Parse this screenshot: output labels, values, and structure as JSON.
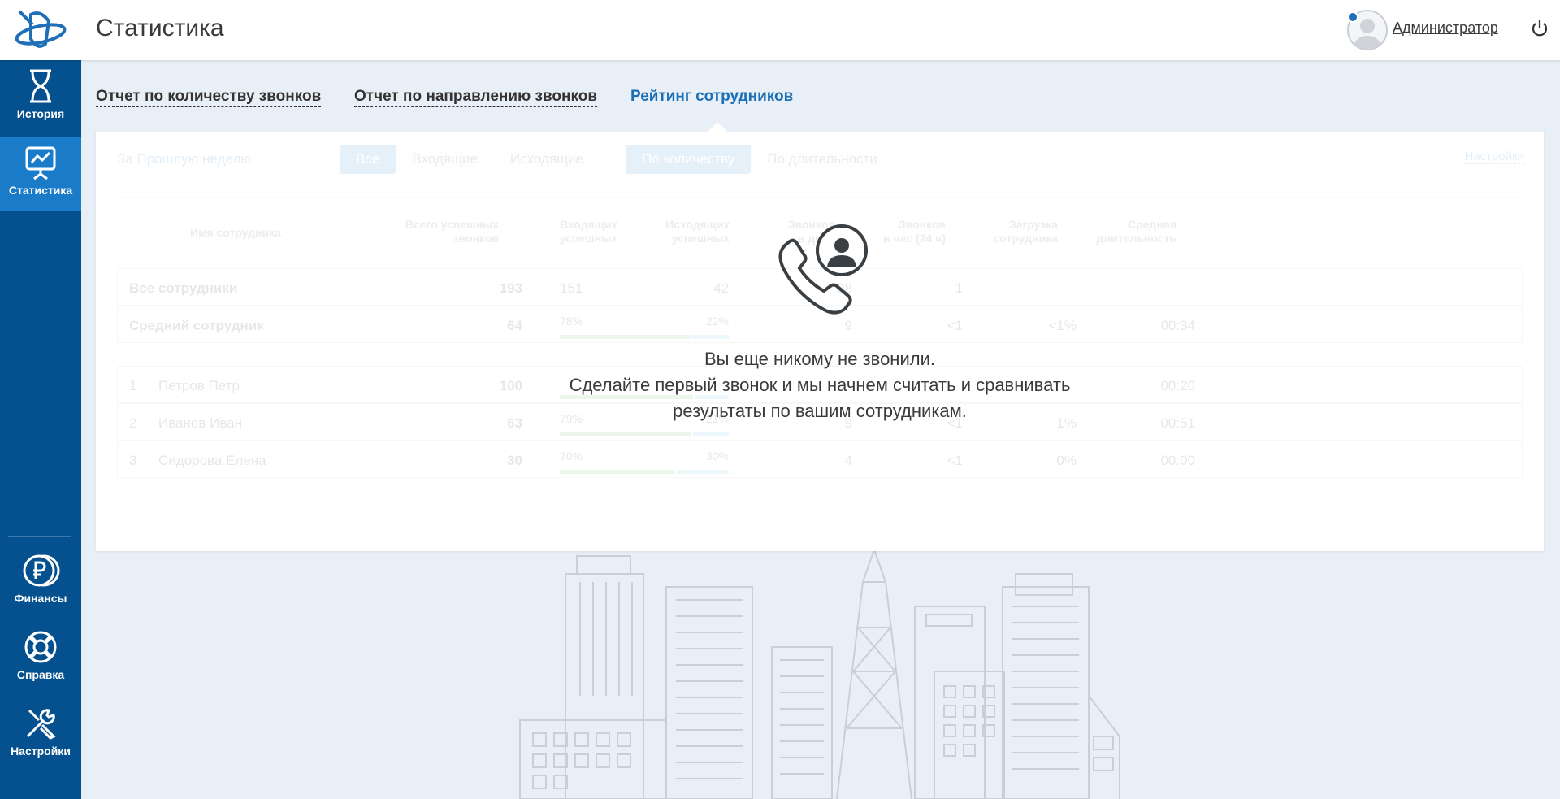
{
  "header": {
    "title": "Статистика",
    "user_name": "Администратор"
  },
  "sidebar": {
    "items": [
      {
        "label": "История",
        "icon": "hourglass-icon",
        "active": false
      },
      {
        "label": "Статистика",
        "icon": "presentation-chart-icon",
        "active": true
      },
      {
        "label": "Финансы",
        "icon": "ruble-coins-icon",
        "active": false
      },
      {
        "label": "Справка",
        "icon": "lifebuoy-icon",
        "active": false
      },
      {
        "label": "Настройки",
        "icon": "tools-icon",
        "active": false
      }
    ]
  },
  "tabs": [
    {
      "label": "Отчет по количеству звонков",
      "active": false
    },
    {
      "label": "Отчет по направлению звонков",
      "active": false
    },
    {
      "label": "Рейтинг сотрудников",
      "active": true
    }
  ],
  "filters": {
    "period_prefix": "За",
    "period_value": "Прошлую неделю",
    "direction": [
      "Все",
      "Входящие",
      "Исходящие"
    ],
    "direction_selected": "Все",
    "metric": [
      "По количеству",
      "По длительности"
    ],
    "metric_selected": "По количеству",
    "settings_label": "Настройки"
  },
  "table": {
    "columns": {
      "name": "Имя сотрудника",
      "total": [
        "Всего успешных",
        "звонков"
      ],
      "incoming": [
        "Входящих",
        "успешных"
      ],
      "outgoing": [
        "Исходящих",
        "успешных"
      ],
      "calls": [
        "Звонков",
        "в день"
      ],
      "per_hour": [
        "Звонков",
        "в час (24 ч)"
      ],
      "load": [
        "Загрузка",
        "сотрудника"
      ],
      "avg": [
        "Средняя",
        "длительность"
      ]
    },
    "summary": [
      {
        "name": "Все сотрудники",
        "total": "193",
        "incoming": "151",
        "outgoing": "42",
        "calls": "28",
        "per_hour": "1",
        "load": "",
        "avg": ""
      },
      {
        "name": "Средний сотрудник",
        "total": "64",
        "incoming": "78%",
        "outgoing": "22%",
        "calls": "9",
        "per_hour": "<1",
        "load": "<1%",
        "avg": "00:34",
        "in_frac": 0.78
      }
    ],
    "rows": [
      {
        "rank": "1",
        "name": "Петров Петр",
        "total": "100",
        "incoming": "",
        "outgoing": "",
        "calls": "",
        "per_hour": "",
        "load": "",
        "avg": "00:20",
        "in_frac": 0.8
      },
      {
        "rank": "2",
        "name": "Иванов Иван",
        "total": "63",
        "incoming": "79%",
        "outgoing": "21%",
        "calls": "9",
        "per_hour": "<1",
        "load": "1%",
        "avg": "00:51",
        "in_frac": 0.79
      },
      {
        "rank": "3",
        "name": "Сидорова Елена",
        "total": "30",
        "incoming": "70%",
        "outgoing": "30%",
        "calls": "4",
        "per_hour": "<1",
        "load": "0%",
        "avg": "00:00",
        "in_frac": 0.7
      }
    ]
  },
  "empty_state": {
    "icon": "phone-user-icon",
    "line1": "Вы еще никому не звонили.",
    "line2": "Сделайте первый звонок и мы начнем считать и сравнивать",
    "line3": "результаты по вашим сотрудникам."
  },
  "colors": {
    "sidebar": "#05508f",
    "sidebar_active": "#1a7bc9",
    "accent": "#1a6fb5",
    "incoming_bar": "#5cb85c",
    "outgoing_bar": "#5bc0de"
  }
}
